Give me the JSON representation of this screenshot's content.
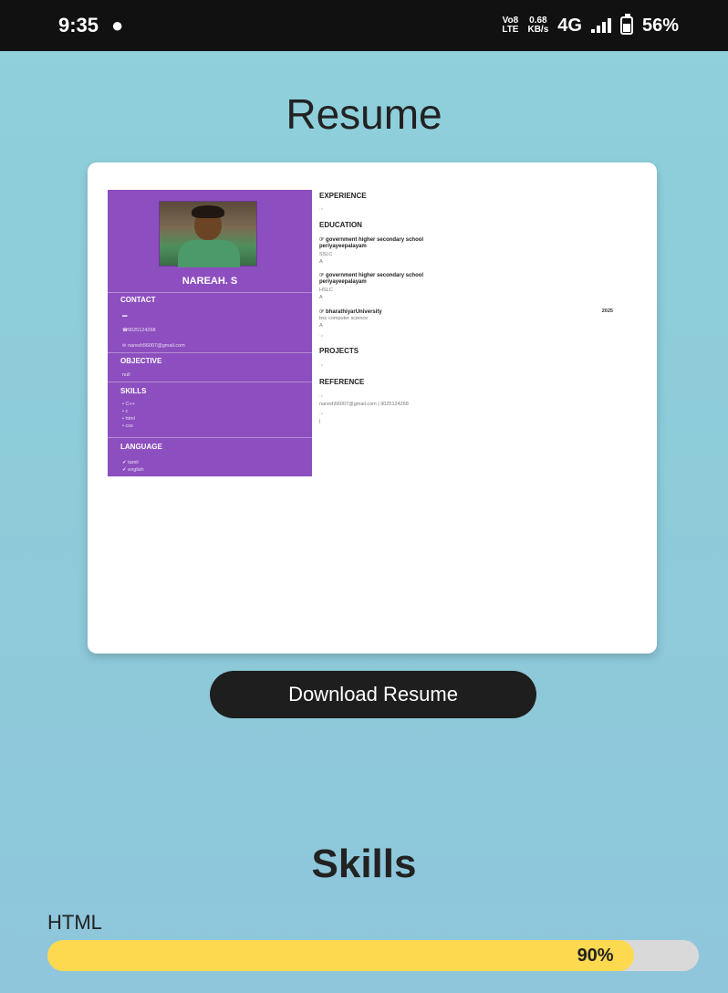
{
  "status_bar": {
    "time": "9:35",
    "network_top": "Vo8",
    "network_bottom": "LTE",
    "speed_top": "0.68",
    "speed_bottom": "KB/s",
    "network_type": "4G",
    "battery": "56%",
    "icons": [
      "app-icon",
      "signal-icon",
      "battery-icon"
    ]
  },
  "page": {
    "title": "Resume",
    "download_button": "Download Resume",
    "skills_title": "Skills"
  },
  "resume": {
    "name": "NAREAH. S",
    "contact_heading": "CONTACT",
    "phone": "9025124268",
    "email": "naresh56007@gmail.com",
    "objective_heading": "OBJECTIVE",
    "objective": "null",
    "skills_heading": "SKILLS",
    "skills": [
      "C++",
      "c",
      "html",
      "css"
    ],
    "language_heading": "LANGUAGE",
    "languages": [
      "tamil",
      "english"
    ],
    "experience_heading": "EXPERIENCE",
    "education_heading": "EDUCATION",
    "education": [
      {
        "school_line1": "government higher secondary school",
        "school_line2": "periyayeepalayam",
        "level": "SSLC",
        "grade": "A"
      },
      {
        "school_line1": "government higher secondary school",
        "school_line2": "periyayeepalayam",
        "level": "HSLC",
        "grade": "A"
      },
      {
        "school_line1": "bharathiyarUniversity",
        "school_line2": "bsc computer science",
        "level": "A",
        "year": "2025"
      }
    ],
    "projects_heading": "PROJECTS",
    "reference_heading": "REFERENCE",
    "reference_contact": "naresh56007@gmail.com | 9025124268",
    "reference_extra": "|"
  },
  "skills_list": [
    {
      "label": "HTML",
      "value": 0.9,
      "display": "90%"
    }
  ],
  "colors": {
    "accent": "#8d4fbf",
    "button": "#1e1e1e",
    "bar": "#fcd94f",
    "track": "#d9d9d9"
  }
}
